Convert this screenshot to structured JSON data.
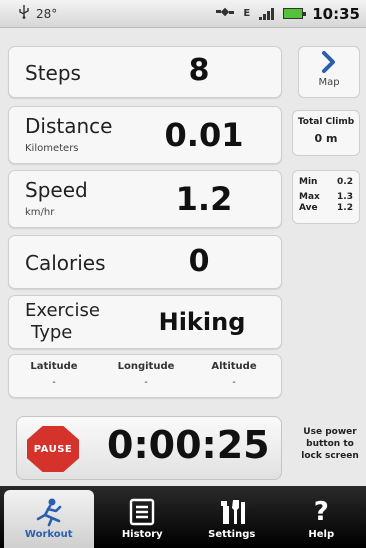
{
  "status_bar": {
    "temperature": "28°",
    "network": "E",
    "time": "10:35"
  },
  "metrics": {
    "steps": {
      "label": "Steps",
      "value": "8"
    },
    "distance": {
      "label": "Distance",
      "unit": "Kilometers",
      "value": "0.01"
    },
    "speed": {
      "label": "Speed",
      "unit": "km/hr",
      "value": "1.2"
    },
    "calories": {
      "label": "Calories",
      "value": "0"
    },
    "exercise_type": {
      "label_line1": "Exercise",
      "label_line2": "Type",
      "value": "Hiking"
    }
  },
  "map_button": {
    "label": "Map"
  },
  "total_climb": {
    "title": "Total Climb",
    "value": "0 m"
  },
  "speed_stats": {
    "min_label": "Min",
    "min_value": "0.2",
    "max_label": "Max",
    "max_value": "1.3",
    "ave_label": "Ave",
    "ave_value": "1.2"
  },
  "gps": {
    "latitude_label": "Latitude",
    "latitude_value": "-",
    "longitude_label": "Longitude",
    "longitude_value": "-",
    "altitude_label": "Altitude",
    "altitude_value": "-"
  },
  "timer": {
    "pause_label": "PAUSE",
    "elapsed": "0:00:25"
  },
  "lock_note": {
    "line1": "Use power",
    "line2": "button to",
    "line3": "lock screen"
  },
  "nav": {
    "workout": "Workout",
    "history": "History",
    "settings": "Settings",
    "help": "Help",
    "help_glyph": "?"
  },
  "colors": {
    "accent_blue": "#2a5fb0",
    "pause_red": "#d6322c",
    "battery_green": "#55c23c"
  },
  "icons": [
    "usb-icon",
    "satellite-icon",
    "signal-icon",
    "battery-icon",
    "chevron-right-icon",
    "runner-icon",
    "history-icon",
    "settings-icon",
    "help-icon"
  ]
}
